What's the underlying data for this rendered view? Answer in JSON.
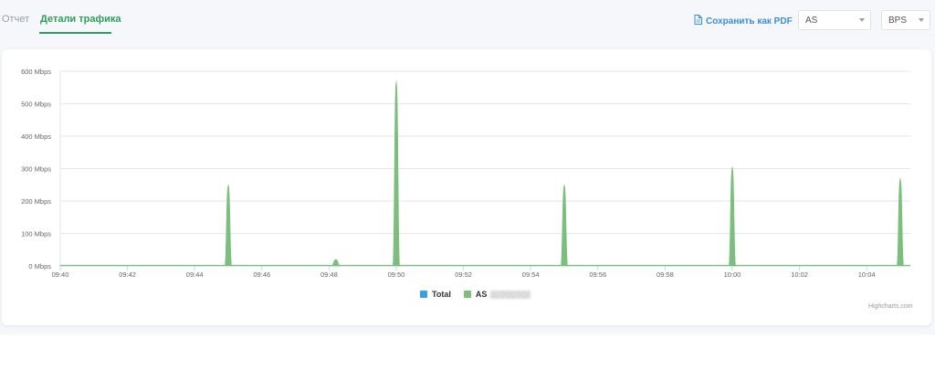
{
  "header": {
    "tab_report": "Отчет",
    "tab_traffic": "Детали трафика",
    "pdf_button": "Сохранить как PDF",
    "select_entity": "AS",
    "select_metric": "BPS"
  },
  "credits": "Highcharts.com",
  "colors": {
    "total": "#3ba0e3",
    "as": "#7cbf7c",
    "accent": "#2e9e57"
  },
  "chart_data": {
    "type": "area",
    "ylim": [
      0,
      600
    ],
    "y_ticks": [
      "0 Mbps",
      "100 Mbps",
      "200 Mbps",
      "300 Mbps",
      "400 Mbps",
      "500 Mbps",
      "600 Mbps"
    ],
    "x_ticks": [
      "09:40",
      "09:42",
      "09:44",
      "09:46",
      "09:48",
      "09:50",
      "09:52",
      "09:54",
      "09:56",
      "09:58",
      "10:00",
      "10:02",
      "10:04"
    ],
    "xlim": [
      "09:40",
      "10:05.3"
    ],
    "legend": [
      "Total",
      "AS"
    ],
    "series": [
      {
        "name": "Total",
        "values": []
      },
      {
        "name": "AS",
        "peaks": [
          {
            "time": "09:45",
            "value": 250
          },
          {
            "time": "09:48.2",
            "value": 20
          },
          {
            "time": "09:50",
            "value": 570
          },
          {
            "time": "09:55",
            "value": 250
          },
          {
            "time": "10:00",
            "value": 305
          },
          {
            "time": "10:05",
            "value": 270
          }
        ]
      }
    ]
  }
}
